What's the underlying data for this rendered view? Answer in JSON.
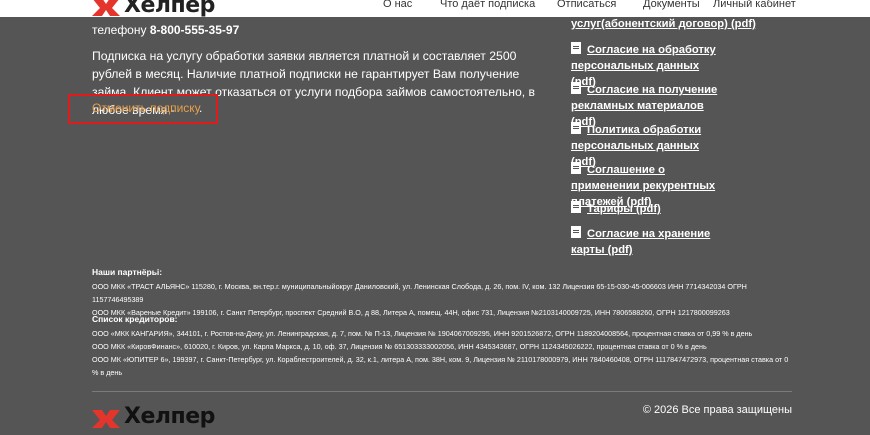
{
  "header": {
    "logo_text": "Хелпер",
    "nav": [
      "О нас",
      "Что даёт подписка",
      "Отписаться",
      "Документы",
      "Личный кабинет"
    ]
  },
  "contact": {
    "prefix": "телефону",
    "phone": "8-800-555-35-97"
  },
  "main": {
    "text": "Подписка на услугу обработки заявки является платной и составляет 2500 рублей в месяц. Наличие платной подписки не гарантирует Вам получение займа. Клиент может отказаться от услуги подбора займов самостоятельно, в любое время -",
    "cancel_link": "Отменить подписку",
    "cancel_suffix": "."
  },
  "documents": [
    "услуг(абонентский договор) (pdf)",
    "Согласие на обработку персональных данных (pdf)",
    "Согласие на получение рекламных материалов (pdf)",
    "Политика обработки персональных данных (pdf)",
    "Соглашение о применении рекурентных платежей (pdf)",
    "Тарифы (pdf)",
    "Согласие на хранение карты (pdf)"
  ],
  "partners": {
    "heading": "Наши партнёрьі:",
    "items": [
      "ООО МКК «ТРАСТ АЛЬЯНС» 115280, г. Москва, вн.тер.г. муниципальныйокруг Даниловский, ул. Ленинская Слобода, д. 26, пом. IV, ком. 132 Лицензия 65-15-030-45-006603 ИНН 7714342034 ОГРН 1157746495389",
      "ООО МКК «Вареные Кредит» 199106, г. Санкт Петербург, проспект Средний В.О, д 88, Литера А, помещ. 44Н, офис 731, Лицензия №2103140009725, ИНН 7806588260, ОГРН 1217800099263"
    ]
  },
  "creditors": {
    "heading": "Список кредиторов:",
    "items": [
      "ООО «МКК КАНГАРИЯ», 344101, г. Ростов-на-Дону, ул. Ленинградская, д. 7, пом. № П-13, Лицензия № 1904067009295, ИНН 9201526872, ОГРН 1189204008564, процентная ставка от 0,99 % в день",
      "ООО МКК «КировФинанс», 610020, г. Киров, ул. Карла Маркса, д. 10, оф. 37, Лицензия № 651303333002056, ИНН 4345343687, ОГРН 1124345026222, процентная ставка от 0 % в день",
      "ООО МК «ЮПИТЕР 6», 199397, г. Санкт-Петербург, ул. Кораблестроителей, д. 32, к.1, литера А, пом. 38Н, ком. 9, Лицензия № 2110178000979, ИНН 7840460408, ОГРН 1117847472973, процентная ставка от 0 % в день"
    ]
  },
  "footer": {
    "logo_text": "Хелпер",
    "copyright": "© 2026 Все права защищены"
  },
  "colors": {
    "background": "#555555",
    "link_accent": "#e8a04b",
    "highlight_box": "#e01b1b",
    "logo_red": "#e3352b"
  }
}
